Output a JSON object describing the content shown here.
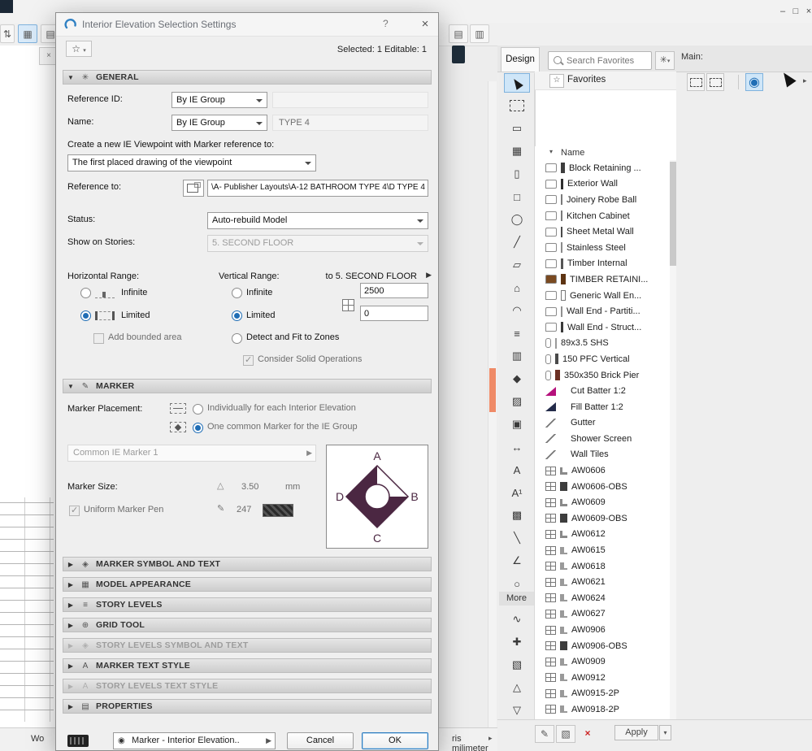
{
  "window": {
    "minimize": "–",
    "maximize": "□",
    "close": "×"
  },
  "status_bar": {
    "left_text": "Wo",
    "units_text": "ris milimeter"
  },
  "dialog": {
    "title": "Interior Elevation Selection Settings",
    "help": "?",
    "close": "×",
    "selected_info": "Selected: 1 Editable: 1",
    "general": {
      "header": "GENERAL",
      "reference_id_label": "Reference ID:",
      "reference_id_value": "By IE Group",
      "name_label": "Name:",
      "name_value": "By IE Group",
      "name_text": "TYPE 4",
      "viewpoint_label": "Create a new IE Viewpoint with Marker reference to:",
      "viewpoint_value": "The first placed drawing of the viewpoint",
      "reference_to_label": "Reference to:",
      "reference_to_value": "\\A- Publisher Layouts\\A-12 BATHROOM TYPE 4\\D TYPE 4",
      "status_label": "Status:",
      "status_value": "Auto-rebuild Model",
      "stories_label": "Show on Stories:",
      "stories_value": "5. SECOND FLOOR",
      "horizontal_label": "Horizontal Range:",
      "vertical_label": "Vertical Range:",
      "to_story": "to 5. SECOND FLOOR",
      "infinite": "Infinite",
      "limited": "Limited",
      "add_bounded": "Add bounded area",
      "detect_fit": "Detect and Fit to Zones",
      "consider_solid": "Consider Solid Operations",
      "top_value": "2500",
      "bottom_value": "0"
    },
    "marker": {
      "header": "MARKER",
      "placement_label": "Marker Placement:",
      "individually": "Individually for each Interior Elevation",
      "common": "One common Marker for the IE Group",
      "marker_name": "Common IE Marker 1",
      "size_label": "Marker Size:",
      "size_value": "3.50",
      "size_unit": "mm",
      "uniform_pen": "Uniform Marker Pen",
      "pen_number": "247",
      "letters": {
        "top": "A",
        "right": "B",
        "bottom": "C",
        "left": "D"
      },
      "marker_color": "#4b2742"
    },
    "collapsed_sections": [
      {
        "label": "MARKER SYMBOL AND TEXT",
        "icon": "◈",
        "disabled": false
      },
      {
        "label": "MODEL APPEARANCE",
        "icon": "▦",
        "disabled": false
      },
      {
        "label": "STORY LEVELS",
        "icon": "≡",
        "disabled": false
      },
      {
        "label": "GRID TOOL",
        "icon": "⊕",
        "disabled": false
      },
      {
        "label": "STORY LEVELS SYMBOL AND TEXT",
        "icon": "◈",
        "disabled": true
      },
      {
        "label": "MARKER TEXT STYLE",
        "icon": "A",
        "disabled": false
      },
      {
        "label": "STORY LEVELS TEXT STYLE",
        "icon": "A",
        "disabled": true
      },
      {
        "label": "PROPERTIES",
        "icon": "▤",
        "disabled": false
      }
    ],
    "footer": {
      "style_value": "Marker - Interior Elevation..",
      "cancel": "Cancel",
      "ok": "OK"
    }
  },
  "right_panel": {
    "design_tab": "Design",
    "search_placeholder": "Search Favorites",
    "favorites_title": "Favorites",
    "list_header": "Name",
    "more_label": "More",
    "apply_label": "Apply",
    "main_label": "Main:",
    "toolbox": [
      {
        "name": "arrow-tool",
        "kind": "cursor",
        "selected": true
      },
      {
        "name": "marquee-tool",
        "kind": "marquee"
      },
      {
        "name": "wall-tool",
        "glyph": "▭"
      },
      {
        "name": "curtain-wall-tool",
        "glyph": "▦"
      },
      {
        "name": "door-tool",
        "glyph": "▯"
      },
      {
        "name": "window-tool",
        "glyph": "□"
      },
      {
        "name": "column-tool",
        "glyph": "◯"
      },
      {
        "name": "beam-tool",
        "glyph": "╱"
      },
      {
        "name": "slab-tool",
        "glyph": "▱"
      },
      {
        "name": "roof-tool",
        "glyph": "⌂"
      },
      {
        "name": "shell-tool",
        "glyph": "◠"
      },
      {
        "name": "stair-tool",
        "glyph": "≡"
      },
      {
        "name": "railing-tool",
        "glyph": "▥"
      },
      {
        "name": "morph-tool",
        "glyph": "◆"
      },
      {
        "name": "mesh-tool",
        "glyph": "▨"
      },
      {
        "name": "zone-tool",
        "glyph": "▣"
      },
      {
        "name": "dimension-tool",
        "glyph": "↔"
      },
      {
        "name": "text-tool",
        "glyph": "A"
      },
      {
        "name": "label-tool",
        "glyph": "A¹"
      },
      {
        "name": "fill-tool",
        "glyph": "▩"
      },
      {
        "name": "line-tool",
        "glyph": "╲"
      },
      {
        "name": "polyline-tool",
        "glyph": "∠"
      },
      {
        "name": "circle-tool",
        "glyph": "○"
      }
    ],
    "toolbox_more": [
      {
        "name": "spline-tool",
        "glyph": "∿"
      },
      {
        "name": "hotspot-tool",
        "glyph": "✚"
      },
      {
        "name": "figure-tool",
        "glyph": "▧"
      },
      {
        "name": "camera-tool",
        "glyph": "△"
      },
      {
        "name": "section-tool",
        "glyph": "▽"
      }
    ],
    "favorites": [
      {
        "label": "Block Retaining ...",
        "lead": "wall",
        "sw": "bar",
        "c": "#3d3d3d",
        "w": 5
      },
      {
        "label": "Exterior Wall",
        "lead": "wall",
        "sw": "bar",
        "c": "#2e2e2e",
        "w": 3
      },
      {
        "label": "Joinery Robe Ball",
        "lead": "wall",
        "sw": "bar",
        "c": "#7a7a7a",
        "w": 2
      },
      {
        "label": "Kitchen Cabinet",
        "lead": "wall",
        "sw": "bar",
        "c": "#7a7a7a",
        "w": 2
      },
      {
        "label": "Sheet Metal Wall",
        "lead": "wall",
        "sw": "bar",
        "c": "#4a4a4a",
        "w": 2
      },
      {
        "label": "Stainless Steel",
        "lead": "wall",
        "sw": "bar",
        "c": "#8a8a8a",
        "w": 2
      },
      {
        "label": "Timber Internal",
        "lead": "wall",
        "sw": "bar",
        "c": "#555555",
        "w": 3
      },
      {
        "label": "TIMBER RETAINI...",
        "lead": "wall",
        "leadFill": "#7a4a21",
        "sw": "bar",
        "c": "#5e3413",
        "w": 6
      },
      {
        "label": "Generic Wall En...",
        "lead": "wall",
        "sw": "outline"
      },
      {
        "label": "Wall End - Partiti...",
        "lead": "wall",
        "sw": "bar",
        "c": "#909090",
        "w": 2
      },
      {
        "label": "Wall End - Struct...",
        "lead": "wall",
        "sw": "bar",
        "c": "#3a3a3a",
        "w": 3
      },
      {
        "label": "89x3.5 SHS",
        "lead": "col",
        "sw": "bar",
        "c": "#9a9a9a",
        "w": 2
      },
      {
        "label": "150 PFC Vertical",
        "lead": "col",
        "sw": "bar",
        "c": "#4a4a4a",
        "w": 4
      },
      {
        "label": "350x350 Brick Pier",
        "lead": "col",
        "sw": "bar",
        "c": "#6b2f23",
        "w": 6
      },
      {
        "label": "Cut Batter 1:2",
        "lead": "wedge",
        "leadFill": "#b5117c",
        "sw": "none"
      },
      {
        "label": "Fill Batter 1:2",
        "lead": "wedge",
        "leadFill": "#232b4a",
        "sw": "none"
      },
      {
        "label": "Gutter",
        "lead": "line",
        "sw": "none"
      },
      {
        "label": "Shower Screen",
        "lead": "line",
        "sw": "none"
      },
      {
        "label": "Wall Tiles",
        "lead": "line",
        "sw": "none"
      },
      {
        "label": "AW0606",
        "lead": "win",
        "sw": "sill"
      },
      {
        "label": "AW0606-OBS",
        "lead": "win",
        "sw": "dark"
      },
      {
        "label": "AW0609",
        "lead": "win",
        "sw": "sill"
      },
      {
        "label": "AW0609-OBS",
        "lead": "win",
        "sw": "dark"
      },
      {
        "label": "AW0612",
        "lead": "win",
        "sw": "sill"
      },
      {
        "label": "AW0615",
        "lead": "win",
        "sw": "sill2"
      },
      {
        "label": "AW0618",
        "lead": "win",
        "sw": "sill2"
      },
      {
        "label": "AW0621",
        "lead": "win",
        "sw": "sill2"
      },
      {
        "label": "AW0624",
        "lead": "win",
        "sw": "sill2"
      },
      {
        "label": "AW0627",
        "lead": "win",
        "sw": "sill2"
      },
      {
        "label": "AW0906",
        "lead": "win",
        "sw": "sill2"
      },
      {
        "label": "AW0906-OBS",
        "lead": "win",
        "sw": "dark"
      },
      {
        "label": "AW0909",
        "lead": "win",
        "sw": "sill2"
      },
      {
        "label": "AW0912",
        "lead": "win",
        "sw": "sill2"
      },
      {
        "label": "AW0915-2P",
        "lead": "win",
        "sw": "sill2"
      },
      {
        "label": "AW0918-2P",
        "lead": "win",
        "sw": "sill2"
      }
    ]
  }
}
